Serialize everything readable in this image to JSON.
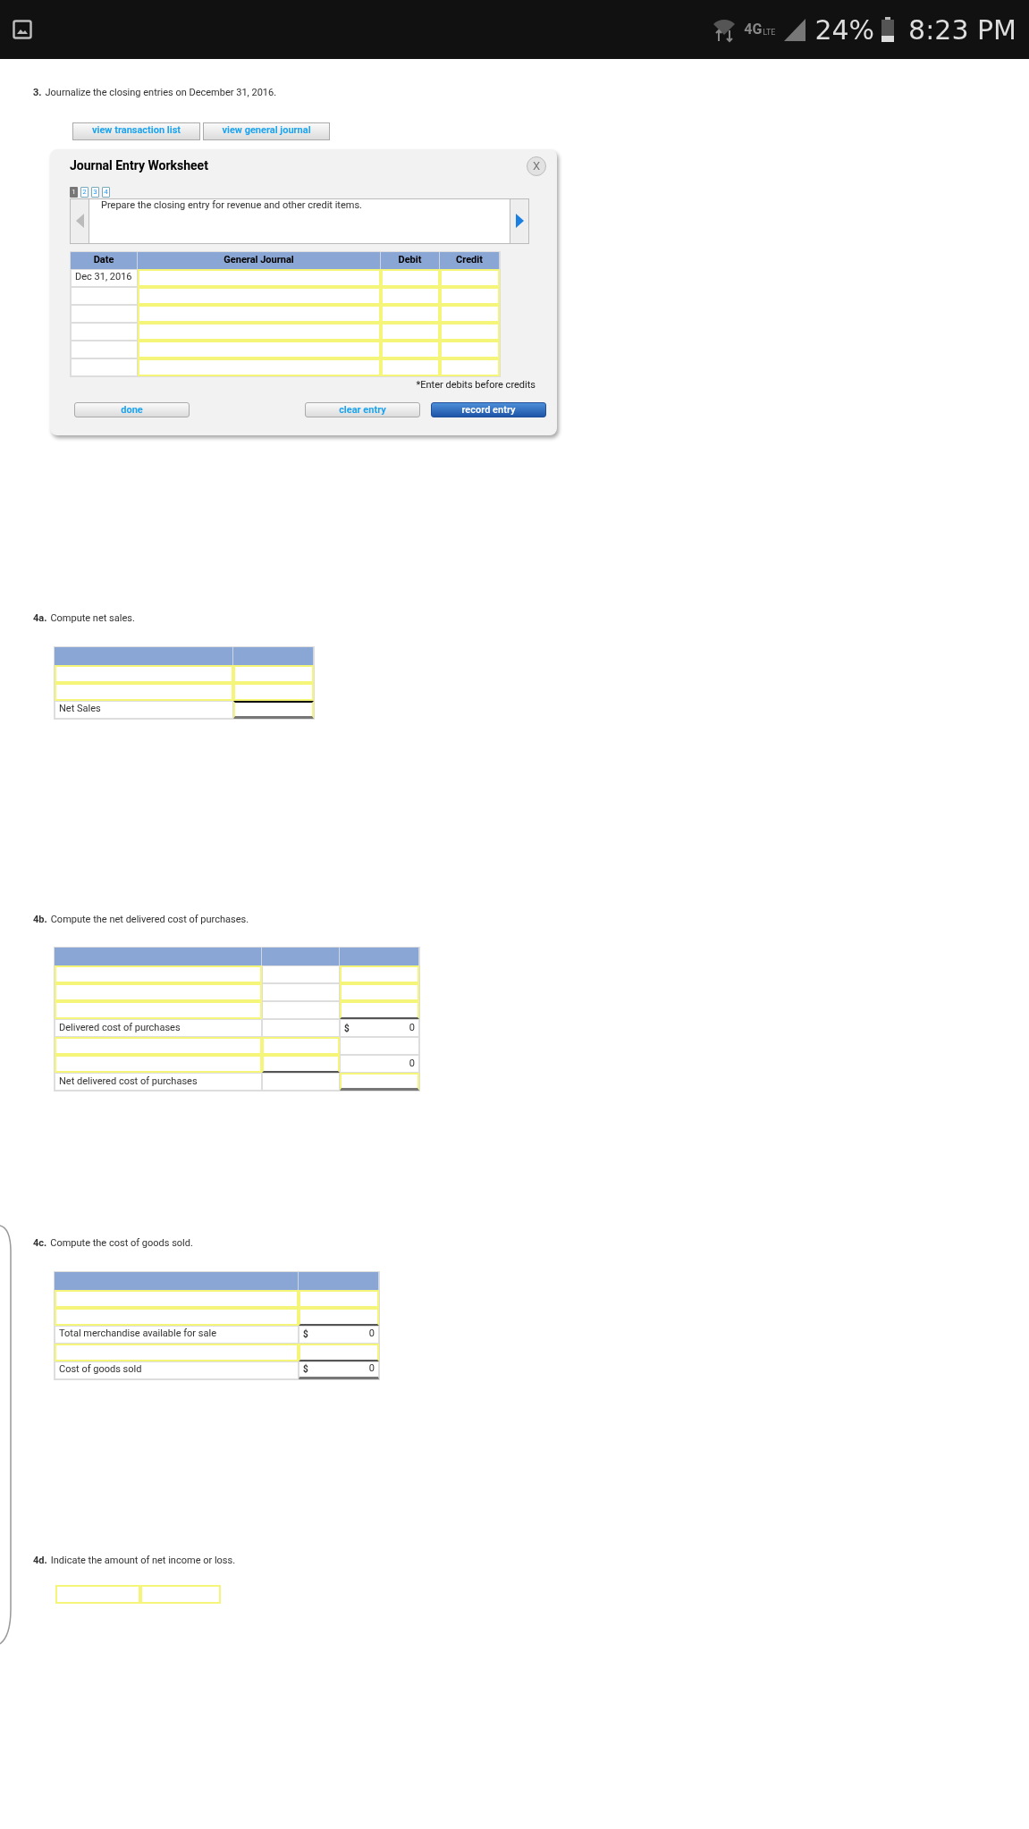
{
  "status_bar": {
    "network": "4G",
    "network_sub": "LTE",
    "battery": "24%",
    "time": "8:23 PM"
  },
  "q3": {
    "number": "3.",
    "text": "Journalize the closing entries on December 31, 2016.",
    "buttons": [
      "view transaction list",
      "view general journal"
    ],
    "worksheet": {
      "title": "Journal Entry Worksheet",
      "close": "X",
      "pages": [
        {
          "label": "1",
          "selected": true
        },
        {
          "label": "2",
          "selected": false
        },
        {
          "label": "3",
          "selected": false
        },
        {
          "label": "4",
          "selected": false
        }
      ],
      "prev": {
        "disabled": true
      },
      "next": {
        "disabled": false
      },
      "instruction": "Prepare the closing entry for revenue and other credit items.",
      "columns": [
        "Date",
        "General Journal",
        "Debit",
        "Credit"
      ],
      "rows": [
        {
          "date": "Dec 31, 2016"
        },
        {
          "date": ""
        },
        {
          "date": ""
        },
        {
          "date": ""
        },
        {
          "date": ""
        },
        {
          "date": ""
        }
      ],
      "note": "*Enter debits before credits",
      "actions": [
        {
          "label": "done",
          "kind": "plain"
        },
        {
          "label": "clear entry",
          "kind": "plain"
        },
        {
          "label": "record entry",
          "kind": "primary"
        }
      ]
    }
  },
  "q4a": {
    "number": "4a.",
    "text": "Compute net sales.",
    "rows": [
      [
        {
          "kind": "input"
        },
        {
          "kind": "input"
        }
      ],
      [
        {
          "kind": "input"
        },
        {
          "kind": "input"
        }
      ],
      [
        {
          "kind": "label",
          "text": "Net Sales"
        },
        {
          "kind": "input",
          "total_line_above": true,
          "double_underline": true
        }
      ]
    ]
  },
  "q4b": {
    "number": "4b.",
    "text": "Compute the net delivered cost of purchases.",
    "rows": [
      [
        {
          "kind": "input"
        },
        {
          "kind": "blank"
        },
        {
          "kind": "input"
        }
      ],
      [
        {
          "kind": "input"
        },
        {
          "kind": "blank"
        },
        {
          "kind": "input"
        }
      ],
      [
        {
          "kind": "input"
        },
        {
          "kind": "blank"
        },
        {
          "kind": "input",
          "underline": true
        }
      ],
      [
        {
          "kind": "label",
          "text": "Delivered cost of purchases"
        },
        {
          "kind": "blank"
        },
        {
          "kind": "value",
          "currency": "$",
          "text": "0"
        }
      ],
      [
        {
          "kind": "input"
        },
        {
          "kind": "input"
        },
        {
          "kind": "blank"
        }
      ],
      [
        {
          "kind": "input"
        },
        {
          "kind": "input",
          "underline": true
        },
        {
          "kind": "value",
          "text": "0"
        }
      ],
      [
        {
          "kind": "label",
          "text": "Net delivered cost of purchases"
        },
        {
          "kind": "blank"
        },
        {
          "kind": "input",
          "double_underline": true
        }
      ]
    ]
  },
  "q4c": {
    "number": "4c.",
    "text": "Compute the cost of goods sold.",
    "rows": [
      [
        {
          "kind": "input"
        },
        {
          "kind": "input"
        }
      ],
      [
        {
          "kind": "input"
        },
        {
          "kind": "input",
          "underline": true
        }
      ],
      [
        {
          "kind": "label",
          "text": "Total merchandise available for sale"
        },
        {
          "kind": "value",
          "currency": "$",
          "text": "0"
        }
      ],
      [
        {
          "kind": "input"
        },
        {
          "kind": "input",
          "underline": true
        }
      ],
      [
        {
          "kind": "label",
          "text": "Cost of goods sold"
        },
        {
          "kind": "value",
          "currency": "$",
          "text": "0",
          "double_underline": true
        }
      ]
    ]
  },
  "q4d": {
    "number": "4d.",
    "text": "Indicate the amount of net income or loss.",
    "fields": [
      {
        "kind": "input"
      },
      {
        "kind": "input"
      }
    ]
  }
}
